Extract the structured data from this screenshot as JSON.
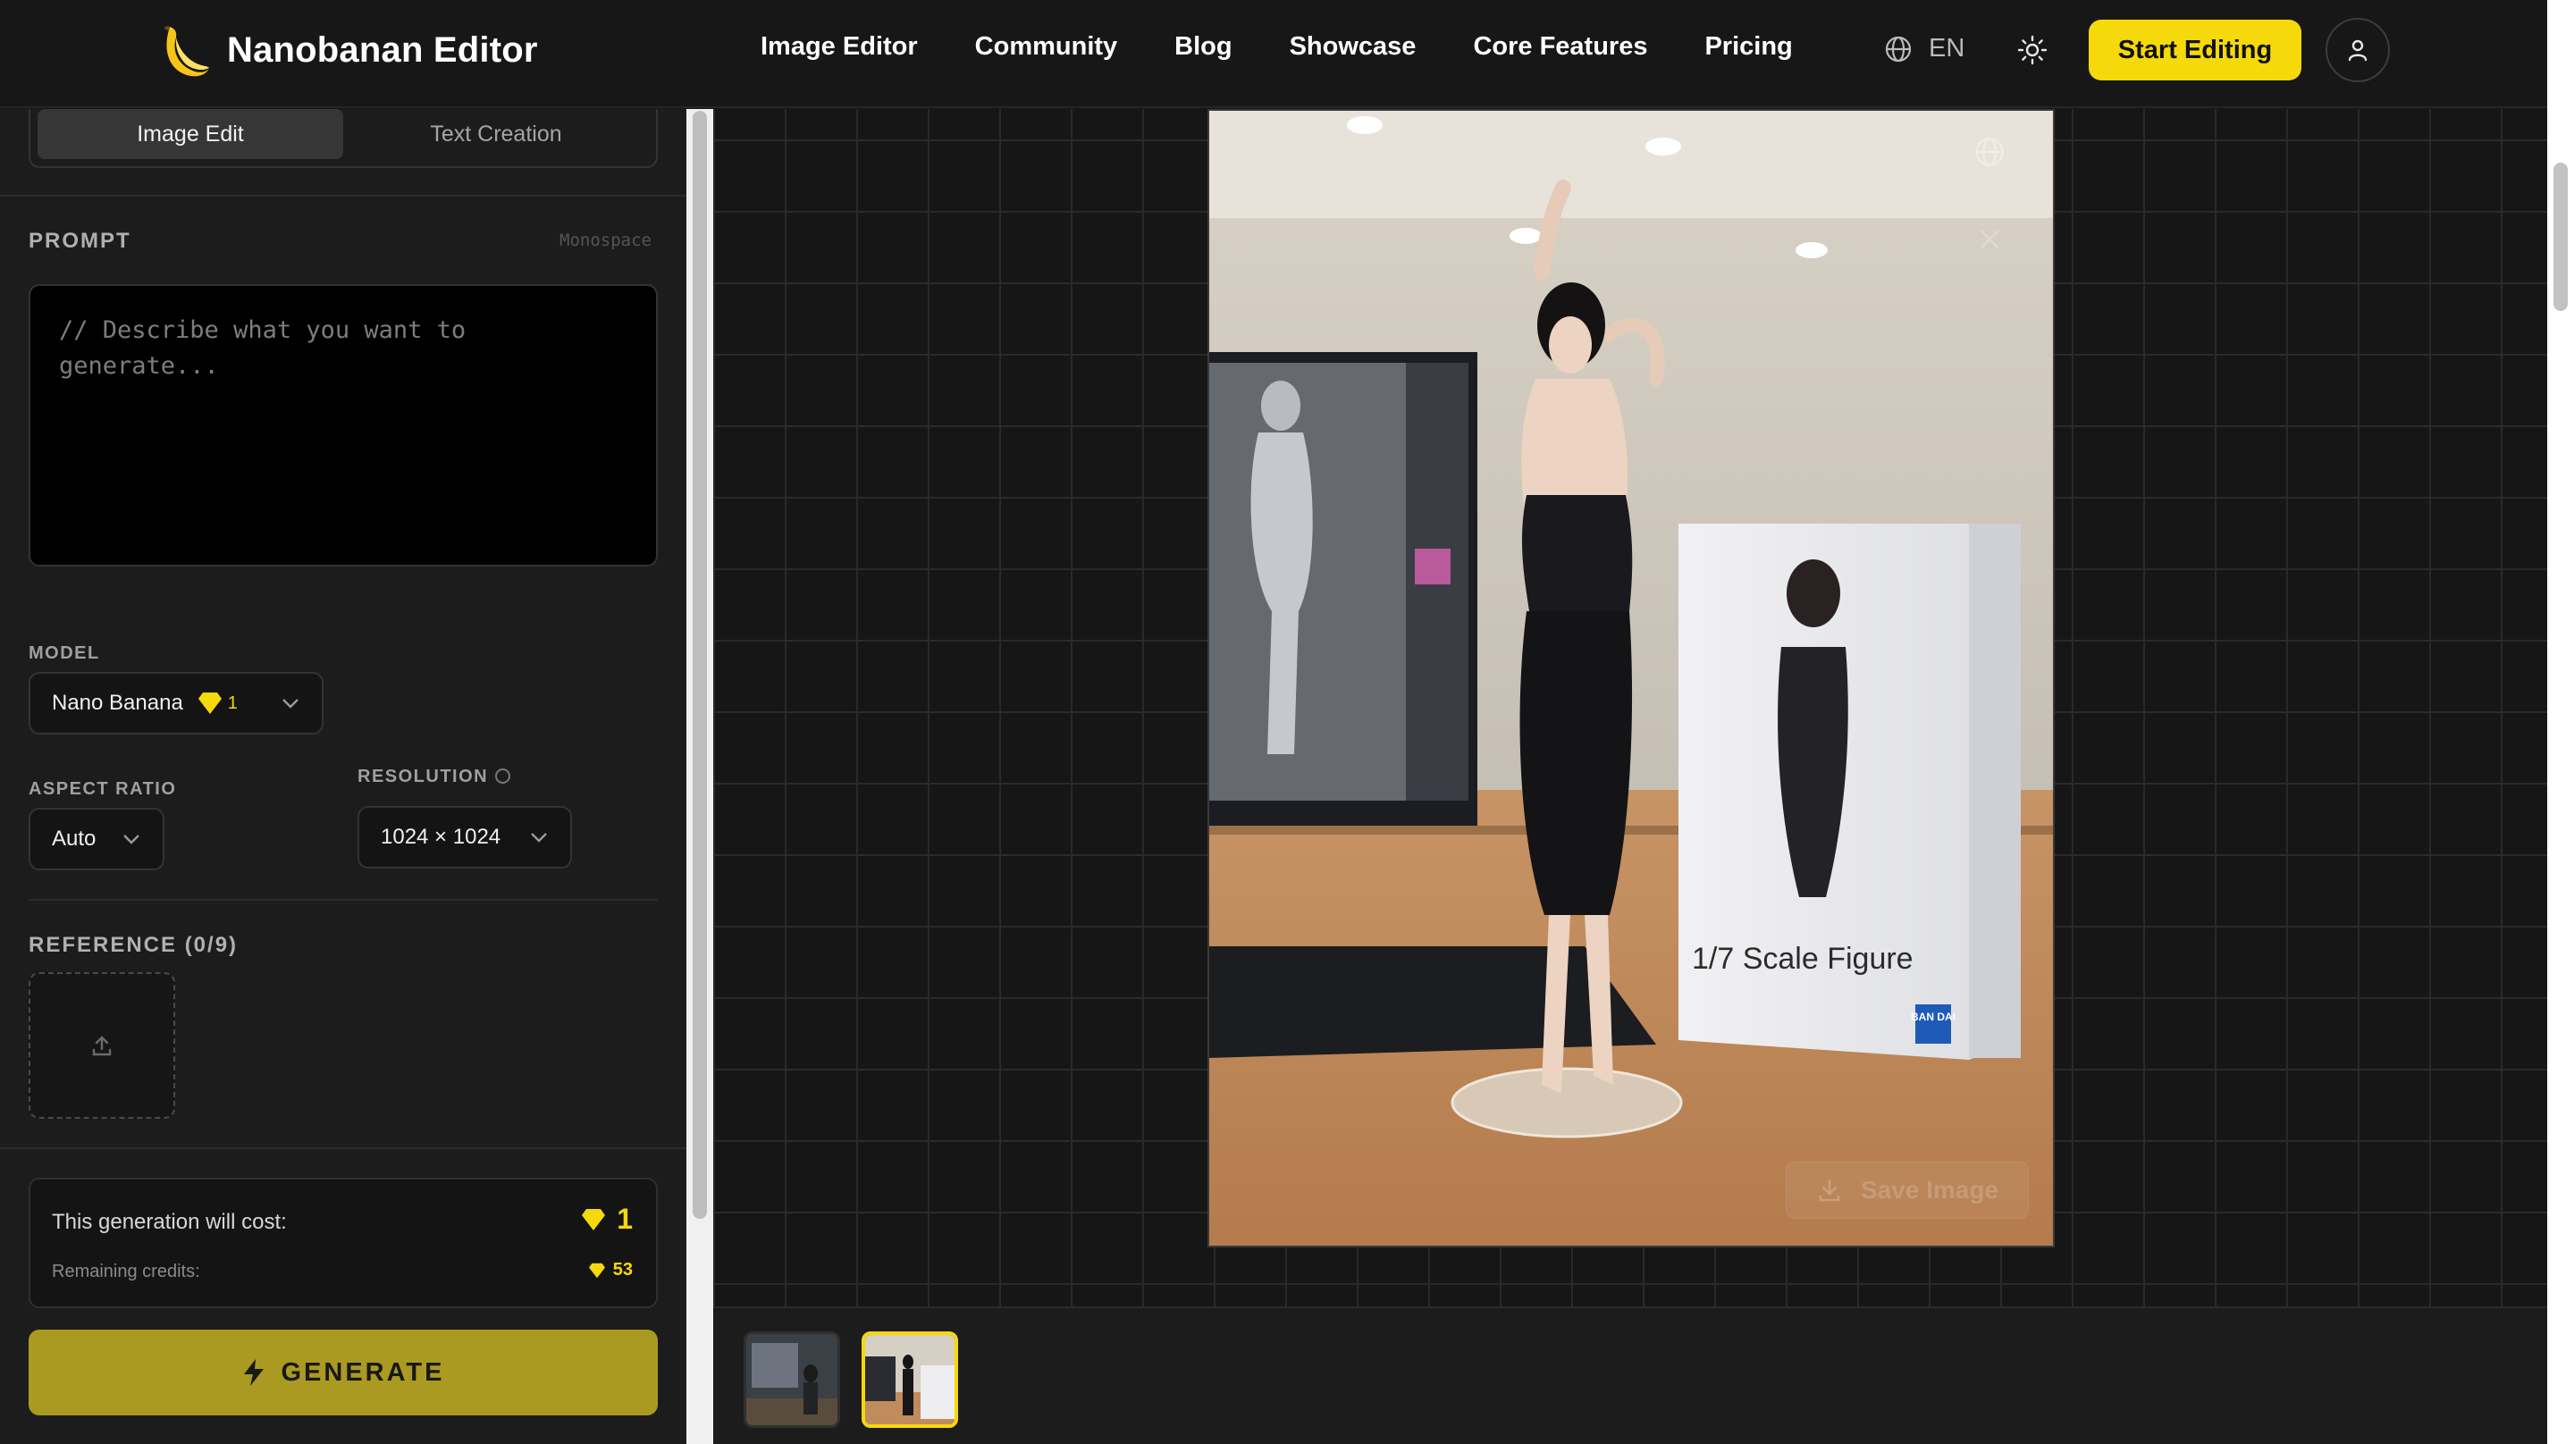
{
  "header": {
    "brand": "Nanobanan Editor",
    "nav": [
      "Image Editor",
      "Community",
      "Blog",
      "Showcase",
      "Core Features",
      "Pricing"
    ],
    "language": "EN",
    "start_button": "Start Editing"
  },
  "sidebar": {
    "tabs": [
      {
        "label": "Image Edit",
        "active": true
      },
      {
        "label": "Text Creation",
        "active": false
      }
    ],
    "prompt": {
      "label": "PROMPT",
      "font_hint": "Monospace",
      "placeholder": "// Describe what you want to generate...",
      "value": ""
    },
    "model": {
      "label": "MODEL",
      "value": "Nano Banana",
      "cost": "1"
    },
    "aspect_ratio": {
      "label": "ASPECT RATIO",
      "value": "Auto"
    },
    "resolution": {
      "label": "RESOLUTION",
      "value": "1024 × 1024"
    },
    "reference": {
      "label": "REFERENCE (0/9)"
    },
    "cost": {
      "line": "This generation will cost:",
      "value": "1",
      "remaining_label": "Remaining credits:",
      "remaining_value": "53"
    },
    "generate_button": "GENERATE"
  },
  "canvas": {
    "save_label": "Save Image",
    "box_title": "1/7 Scale Figure",
    "box_brand": "BAN DAI"
  },
  "colors": {
    "accent": "#f5d90a",
    "generate": "#ab9a22",
    "background": "#151515"
  }
}
